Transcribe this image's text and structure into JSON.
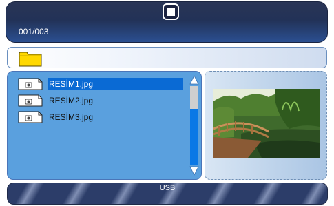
{
  "header": {
    "counter": "001/003",
    "stop_icon": "stop-icon"
  },
  "path_bar": {
    "icon": "folder-icon",
    "folder_color": "#ffd800"
  },
  "file_list": {
    "items": [
      {
        "name": "RESİM1.jpg",
        "selected": true
      },
      {
        "name": "RESİM2.jpg",
        "selected": false
      },
      {
        "name": "RESİM3.jpg",
        "selected": false
      }
    ],
    "selected_color": "#0a6ad4"
  },
  "preview": {
    "image": "preview-thumbnail-garden-bridge"
  },
  "footer": {
    "source": "USB"
  }
}
